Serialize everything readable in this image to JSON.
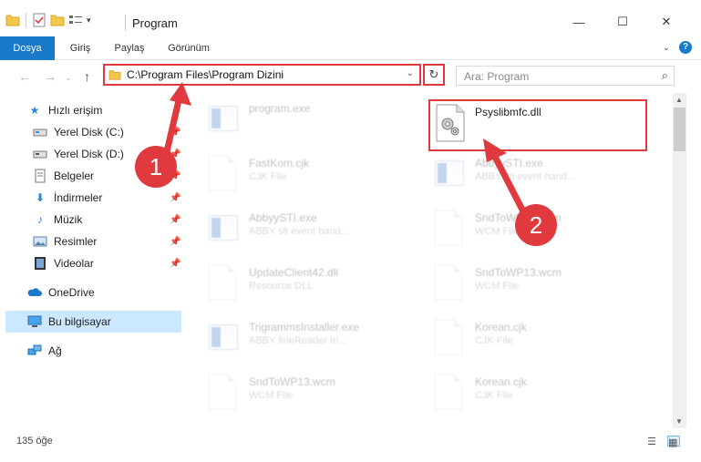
{
  "window": {
    "title": "Program",
    "minimize_glyph": "—",
    "maximize_glyph": "☐",
    "close_glyph": "✕"
  },
  "ribbon": {
    "tabs": [
      {
        "label": "Dosya",
        "active": true
      },
      {
        "label": "Giriş"
      },
      {
        "label": "Paylaş"
      },
      {
        "label": "Görünüm"
      }
    ],
    "help_label": "?"
  },
  "navigation": {
    "back_glyph": "←",
    "forward_glyph": "→",
    "up_glyph": "↑",
    "address": "C:\\Program Files\\Program Dizini",
    "refresh_glyph": "↻",
    "search_placeholder": "Ara: Program"
  },
  "sidebar": {
    "items": [
      {
        "label": "Hızlı erişim",
        "icon": "star-icon"
      },
      {
        "label": "Yerel Disk (C:)",
        "icon": "drive-icon",
        "pinned": true
      },
      {
        "label": "Yerel Disk (D:)",
        "icon": "drive-icon",
        "pinned": true
      },
      {
        "label": "Belgeler",
        "icon": "documents-icon",
        "pinned": true
      },
      {
        "label": "İndirmeler",
        "icon": "download-icon",
        "pinned": true
      },
      {
        "label": "Müzik",
        "icon": "music-icon",
        "pinned": true
      },
      {
        "label": "Resimler",
        "icon": "pictures-icon",
        "pinned": true
      },
      {
        "label": "Videolar",
        "icon": "videos-icon",
        "pinned": true
      },
      {
        "label": "OneDrive",
        "icon": "cloud-icon"
      },
      {
        "label": "Bu bilgisayar",
        "icon": "computer-icon",
        "selected": true
      },
      {
        "label": "Ağ",
        "icon": "network-icon"
      }
    ]
  },
  "files": {
    "left_column": [
      {
        "name": "program.exe",
        "type": "",
        "icon": "exe-icon"
      },
      {
        "name": "FastKom.cjk",
        "type": "CJK File",
        "icon": "document-icon"
      },
      {
        "name": "AbbyySTI.exe",
        "type": "ABBY sti event hand...",
        "icon": "exe-icon"
      },
      {
        "name": "UpdateClient42.dll",
        "type": "Resource DLL",
        "icon": "dll-icon"
      },
      {
        "name": "TrigrammsInstaller.exe",
        "type": "ABBY fineReader tri...",
        "icon": "exe-icon"
      },
      {
        "name": "SndToWP13.wcm",
        "type": "WCM File",
        "icon": "document-icon"
      }
    ],
    "right_column": [
      {
        "name": "Psyslibmfc.dll",
        "type": "",
        "icon": "dll-gear-icon",
        "highlighted": true
      },
      {
        "name": "AbbyySTI.exe",
        "type": "ABBY sti event hand...",
        "icon": "exe-icon"
      },
      {
        "name": "SndToWP13.wcm",
        "type": "WCM File",
        "icon": "document-icon"
      },
      {
        "name": "SndToWP13.wcm",
        "type": "WCM File",
        "icon": "document-icon"
      },
      {
        "name": "Korean.cjk",
        "type": "CJK File",
        "icon": "document-icon"
      },
      {
        "name": "Korean.cjk",
        "type": "CJK File",
        "icon": "document-icon"
      }
    ]
  },
  "status": {
    "item_count": "135 öğe"
  },
  "annotations": {
    "step1": "1",
    "step2": "2"
  },
  "colors": {
    "accent": "#1979ca",
    "annotation": "#e0393e",
    "selected": "#cce8ff"
  }
}
